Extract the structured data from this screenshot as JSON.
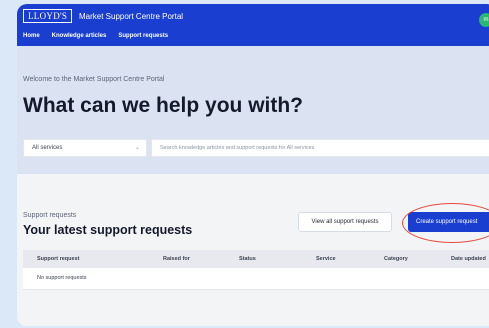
{
  "header": {
    "logo_text": "LLOYD'S",
    "portal_title": "Market Support Centre Portal",
    "avatar_initials": "m",
    "nav": [
      "Home",
      "Knowledge articles",
      "Support requests"
    ]
  },
  "hero": {
    "welcome": "Welcome to the Market Support Centre Portal",
    "headline": "What can we help you with?",
    "service_select": "All services",
    "search_placeholder": "Search knowledge articles and support requests for All services"
  },
  "requests": {
    "label": "Support requests",
    "heading": "Your latest support requests",
    "view_all_button": "View all support requests",
    "create_button": "Create support request",
    "columns": [
      "Support request",
      "Raised for",
      "Status",
      "Service",
      "Category",
      "Date updated"
    ],
    "empty_message": "No support requests"
  },
  "colors": {
    "brand_blue": "#1a3fd0",
    "highlight_ring": "#e84b3c"
  }
}
